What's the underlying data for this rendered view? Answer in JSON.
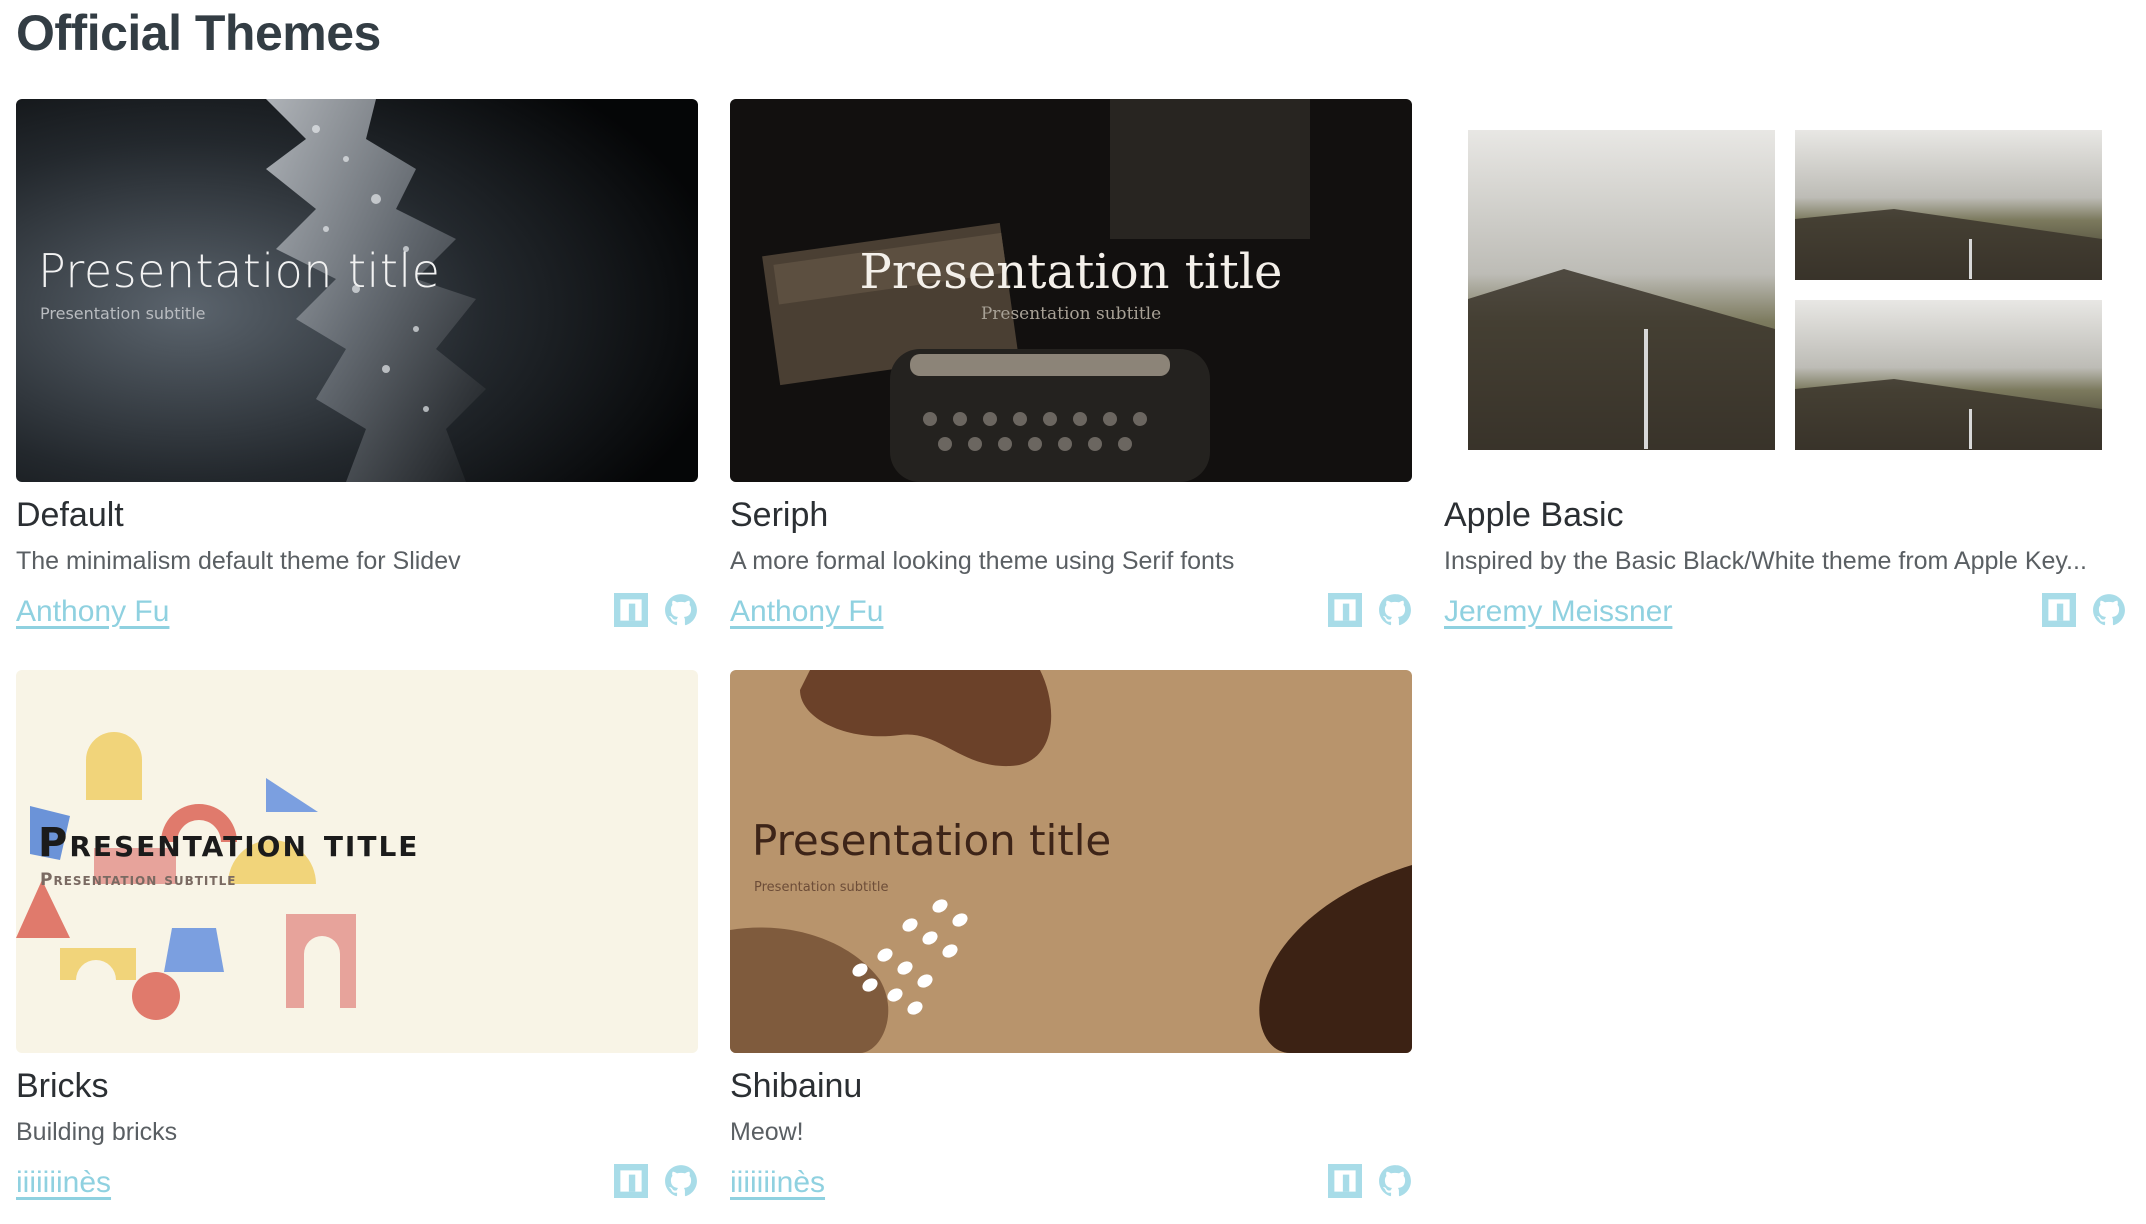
{
  "page": {
    "title": "Official Themes"
  },
  "colors": {
    "link": "#8fd1e0",
    "icon": "#a8dce8",
    "title_text": "#333d44",
    "bricks_bg": "#f8f4e6",
    "shibainu_bg": "#b8946c"
  },
  "themes": [
    {
      "name": "Default",
      "description": "The minimalism default theme for Slidev",
      "author": "Anthony Fu",
      "preview": {
        "title": "Presentation title",
        "subtitle": "Presentation subtitle"
      },
      "icons": [
        "npm-icon",
        "github-icon"
      ]
    },
    {
      "name": "Seriph",
      "description": "A more formal looking theme using Serif fonts",
      "author": "Anthony Fu",
      "preview": {
        "title": "Presentation title",
        "subtitle": "Presentation subtitle"
      },
      "icons": [
        "npm-icon",
        "github-icon"
      ]
    },
    {
      "name": "Apple Basic",
      "description": "Inspired by the Basic Black/White theme from Apple Key...",
      "author": "Jeremy Meissner",
      "icons": [
        "npm-icon",
        "github-icon"
      ]
    },
    {
      "name": "Bricks",
      "description": "Building bricks",
      "author": "iiiiiiinès",
      "preview": {
        "title": "Presentation title",
        "subtitle": "Presentation subtitle"
      },
      "icons": [
        "npm-icon",
        "github-icon"
      ]
    },
    {
      "name": "Shibainu",
      "description": "Meow!",
      "author": "iiiiiiinès",
      "preview": {
        "title": "Presentation title",
        "subtitle": "Presentation subtitle"
      },
      "icons": [
        "npm-icon",
        "github-icon"
      ]
    }
  ]
}
